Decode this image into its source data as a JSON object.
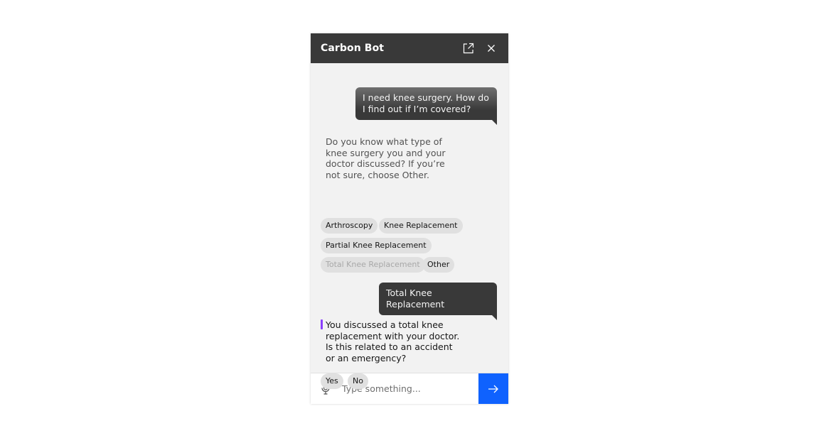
{
  "header": {
    "title": "Carbon Bot",
    "icons": [
      "launch-icon",
      "close-icon"
    ]
  },
  "messages": [
    {
      "from": "user",
      "text": "I need knee surgery. How do I find out if I’m covered?"
    },
    {
      "from": "bot",
      "text": "Do you know what type of knee surgery you and your doctor discussed? If you’re not sure, choose Other.",
      "options": [
        {
          "label": "Arthroscopy",
          "disabled": false
        },
        {
          "label": "Knee Replacement",
          "disabled": false
        },
        {
          "label": "Partial Knee Replacement",
          "disabled": false
        },
        {
          "label": "Total Knee Replacement",
          "disabled": true
        },
        {
          "label": "Other",
          "disabled": false
        }
      ]
    },
    {
      "from": "user",
      "text": "Total Knee Replacement"
    },
    {
      "from": "bot",
      "text": "You discussed a total knee replacement with your doctor. Is this related to an accident or an emergency?",
      "options": [
        {
          "label": "Yes",
          "disabled": false
        },
        {
          "label": "No",
          "disabled": false
        }
      ]
    }
  ],
  "composer": {
    "placeholder": "Type something...",
    "value": "",
    "icons": [
      "microphone-icon",
      "send-arrow-icon"
    ]
  },
  "colors": {
    "header_bg": "#393939",
    "send_button": "#0f62fe",
    "accent_bar": "#8a3ffc"
  }
}
